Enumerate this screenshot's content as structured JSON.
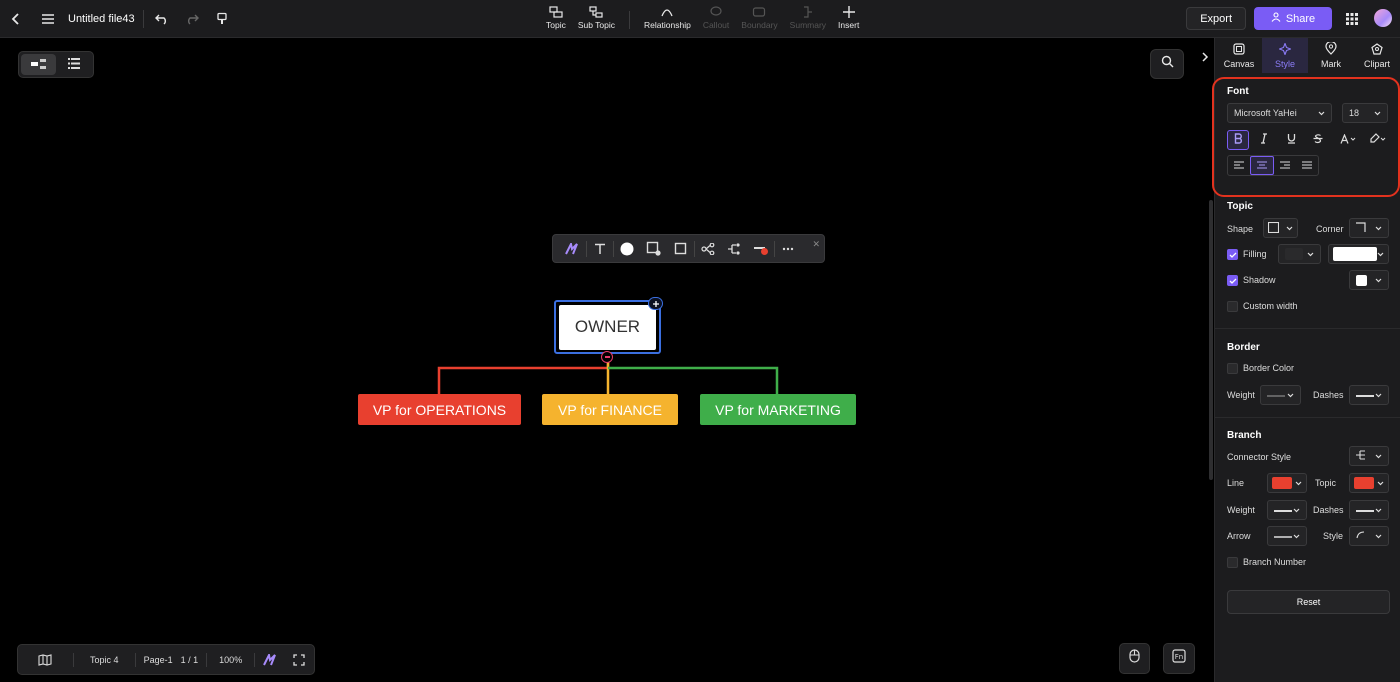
{
  "topbar": {
    "file_title": "Untitled file43",
    "tools": [
      {
        "label": "Topic",
        "icon": "topic-icon",
        "enabled": true
      },
      {
        "label": "Sub Topic",
        "icon": "subtopic-icon",
        "enabled": true
      },
      {
        "label": "Relationship",
        "icon": "relationship-icon",
        "enabled": true
      },
      {
        "label": "Callout",
        "icon": "callout-icon",
        "enabled": false
      },
      {
        "label": "Boundary",
        "icon": "boundary-icon",
        "enabled": false
      },
      {
        "label": "Summary",
        "icon": "summary-icon",
        "enabled": false
      },
      {
        "label": "Insert",
        "icon": "plus-icon",
        "enabled": true
      }
    ],
    "export_label": "Export",
    "share_label": "Share"
  },
  "mindmap": {
    "root": "OWNER",
    "children": [
      {
        "label": "VP for OPERATIONS",
        "color": "#e8402f"
      },
      {
        "label": "VP for FINANCE",
        "color": "#f5b32e"
      },
      {
        "label": "VP for MARKETING",
        "color": "#3fae4a"
      }
    ]
  },
  "bottombar": {
    "topic_count": "Topic 4",
    "page_name": "Page-1",
    "page_num": "1 / 1",
    "zoom": "100%"
  },
  "panel": {
    "tabs": [
      {
        "label": "Canvas",
        "icon": "canvas-icon",
        "active": false
      },
      {
        "label": "Style",
        "icon": "style-icon",
        "active": true
      },
      {
        "label": "Mark",
        "icon": "mark-icon",
        "active": false
      },
      {
        "label": "Clipart",
        "icon": "clipart-icon",
        "active": false
      }
    ],
    "font": {
      "title": "Font",
      "family": "Microsoft YaHei",
      "size": "18",
      "bold_active": true,
      "align_active": "center"
    },
    "topic": {
      "title": "Topic",
      "shape_label": "Shape",
      "corner_label": "Corner",
      "filling_label": "Filling",
      "filling_checked": true,
      "shadow_label": "Shadow",
      "shadow_checked": true,
      "custom_width_label": "Custom width",
      "custom_width_checked": false
    },
    "border": {
      "title": "Border",
      "border_color_label": "Border Color",
      "weight_label": "Weight",
      "dashes_label": "Dashes"
    },
    "branch": {
      "title": "Branch",
      "connector_style_label": "Connector Style",
      "line_label": "Line",
      "line_color": "#e8402f",
      "topic_label": "Topic",
      "topic_color": "#e8402f",
      "weight_label": "Weight",
      "dashes_label": "Dashes",
      "arrow_label": "Arrow",
      "style_label": "Style",
      "branch_number_label": "Branch Number"
    },
    "reset_label": "Reset"
  },
  "colors": {
    "accent": "#7a5cf5",
    "highlight_box": "#e2321e",
    "selection": "#3b6fe0"
  }
}
